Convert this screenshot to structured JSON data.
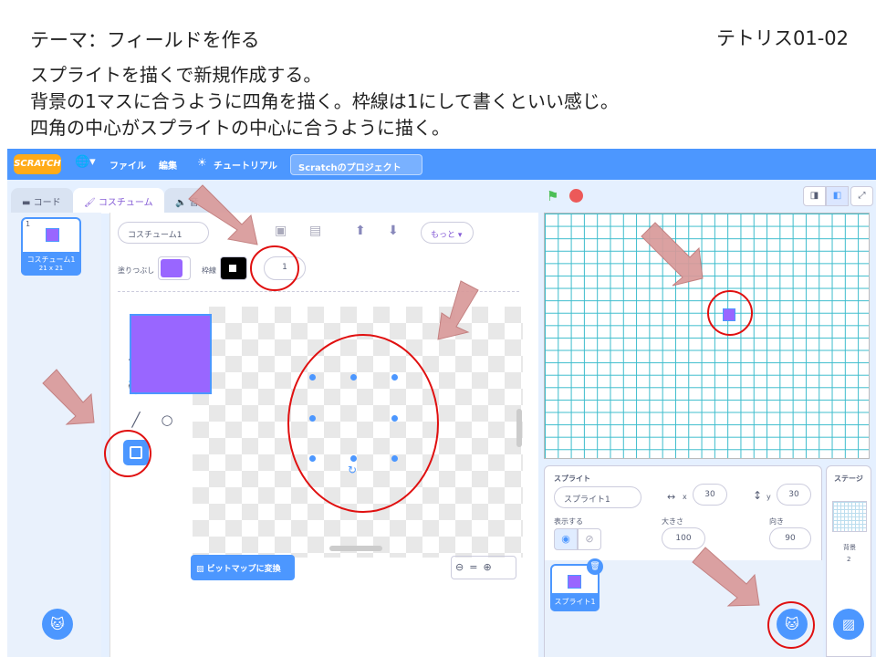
{
  "slide": {
    "theme": "テーマ：フィールドを作る",
    "code": "テトリス01-02",
    "lines": [
      "スプライトを描くで新規作成する。",
      "背景の1マスに合うように四角を描く。枠線は1にして書くといい感じ。",
      "四角の中心がスプライトの中心に合うように描く。"
    ]
  },
  "menubar": {
    "logo": "SCRATCH",
    "file": "ファイル",
    "edit": "編集",
    "tutorial": "チュートリアル",
    "project_title": "Scratchのプロジェクト"
  },
  "tabs": {
    "code": "コード",
    "costume": "コスチューム",
    "sound": "音"
  },
  "costume": {
    "index": "1",
    "name": "コスチューム1",
    "size": "21 x 21"
  },
  "editor": {
    "costume_name": "コスチューム1",
    "more": "もっと",
    "fill_label": "塗りつぶし",
    "outline_label": "枠線",
    "outline_width": "1",
    "fill_color": "#9966ff",
    "convert_bitmap": "ビットマップに変換"
  },
  "sprite_info": {
    "sprite_label": "スプライト",
    "sprite_name": "スプライト1",
    "x_label": "x",
    "x": "30",
    "y_label": "y",
    "y": "30",
    "show_label": "表示する",
    "size_label": "大きさ",
    "size": "100",
    "direction_label": "向き",
    "direction": "90",
    "thumb_name": "スプライト1"
  },
  "stage_pane": {
    "title": "ステージ",
    "backdrop_label": "背景",
    "backdrop_count": "2"
  },
  "colors": {
    "accent": "#4c97ff",
    "sprite": "#9966ff",
    "annotation": "#e01010",
    "arrow": "#d99a9a"
  }
}
